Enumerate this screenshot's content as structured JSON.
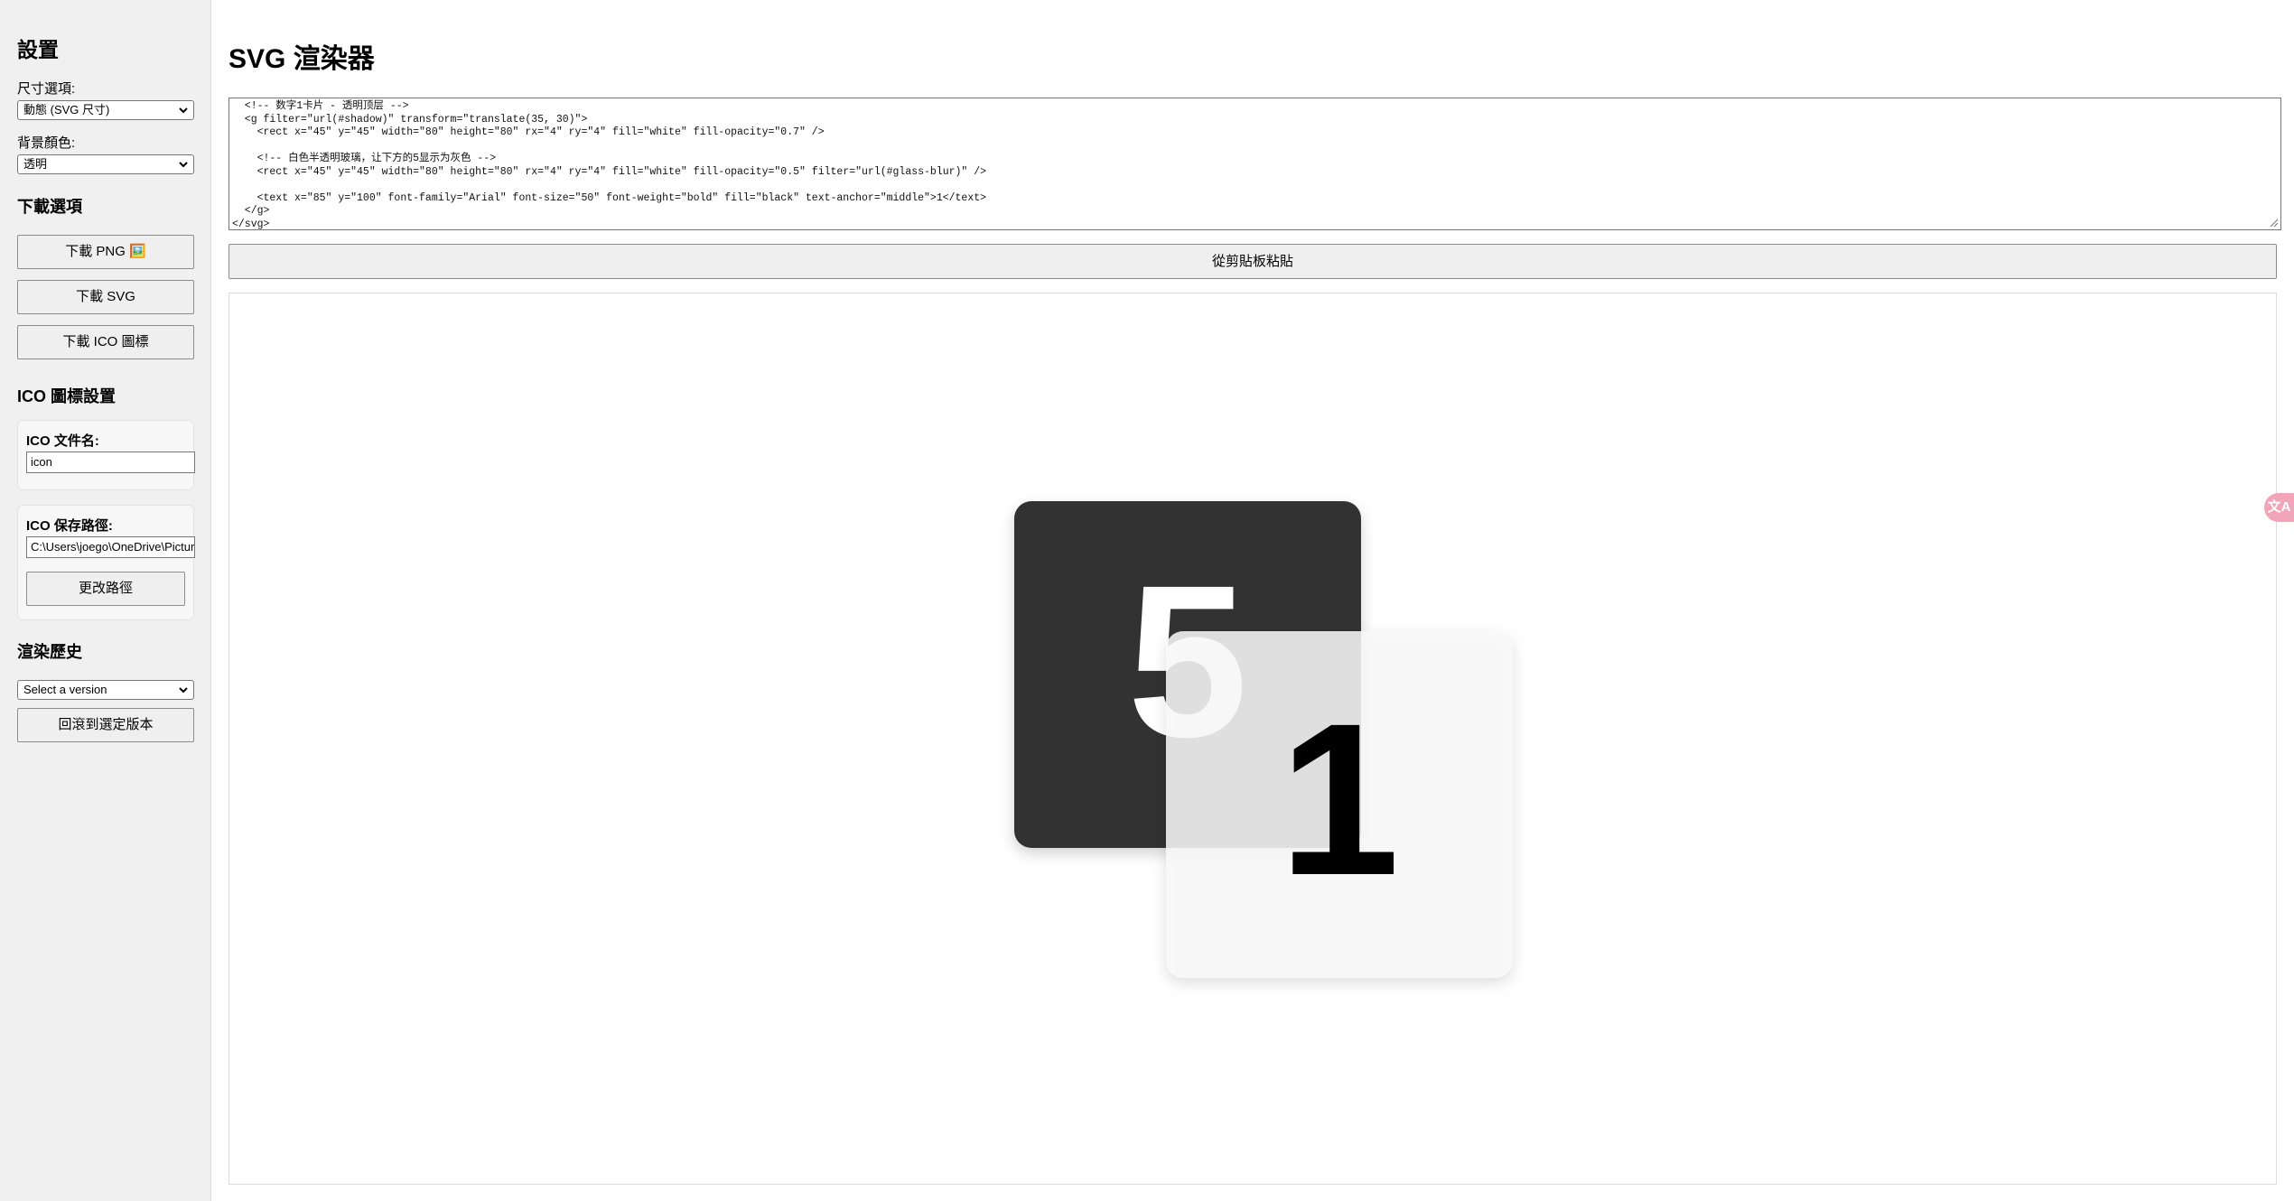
{
  "sidebar": {
    "title": "設置",
    "size_label": "尺寸選項:",
    "size_value": "動態 (SVG 尺寸)",
    "bg_label": "背景顏色:",
    "bg_value": "透明",
    "download_heading": "下載選項",
    "download_png": "下載 PNG 🖼️",
    "download_svg": "下載 SVG",
    "download_ico": "下載 ICO 圖標",
    "ico_heading": "ICO 圖標設置",
    "ico_filename_label": "ICO 文件名:",
    "ico_filename_value": "icon",
    "ico_path_label": "ICO 保存路徑:",
    "ico_path_value": "C:\\Users\\joego\\OneDrive\\Pictures",
    "change_path": "更改路徑",
    "history_heading": "渲染歷史",
    "history_placeholder": "Select a version",
    "rollback": "回滾到選定版本"
  },
  "main": {
    "title": "SVG 渲染器",
    "code": "  <!-- 数字1卡片 - 透明顶层 -->\n  <g filter=\"url(#shadow)\" transform=\"translate(35, 30)\">\n    <rect x=\"45\" y=\"45\" width=\"80\" height=\"80\" rx=\"4\" ry=\"4\" fill=\"white\" fill-opacity=\"0.7\" />\n\n    <!-- 白色半透明玻璃，让下方的5显示为灰色 -->\n    <rect x=\"45\" y=\"45\" width=\"80\" height=\"80\" rx=\"4\" ry=\"4\" fill=\"white\" fill-opacity=\"0.5\" filter=\"url(#glass-blur)\" />\n\n    <text x=\"85\" y=\"100\" font-family=\"Arial\" font-size=\"50\" font-weight=\"bold\" fill=\"black\" text-anchor=\"middle\">1</text>\n  </g>\n</svg>",
    "paste_button": "從剪貼板粘貼",
    "preview": {
      "back_card_digit": "5",
      "front_card_digit": "1",
      "back_card_color": "#333333",
      "front_card_color": "#ffffff"
    }
  },
  "float_tab": {
    "icon": "translate-icon",
    "text": "文A"
  }
}
